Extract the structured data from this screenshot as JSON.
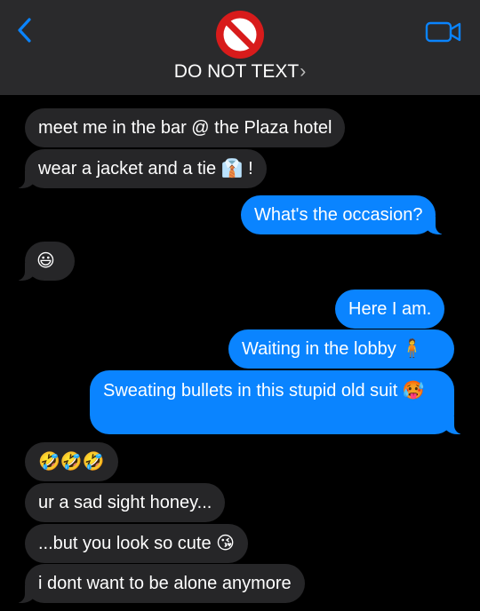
{
  "header": {
    "contact_name": "DO NOT TEXT",
    "chevron": "›",
    "back_icon": "chevron-left-icon",
    "avatar_icon": "prohibited-icon",
    "video_icon": "video-camera-icon",
    "accent_color": "#0a84ff"
  },
  "messages": [
    {
      "side": "incoming",
      "text": "meet me in the bar @ the Plaza hotel"
    },
    {
      "side": "incoming",
      "text": "wear a jacket and a tie 👔 !"
    },
    {
      "side": "outgoing",
      "text": "What's the occasion?"
    },
    {
      "side": "incoming",
      "text": "😃"
    },
    {
      "side": "outgoing",
      "text": "Here I am."
    },
    {
      "side": "outgoing",
      "text": "Waiting in the lobby 🧍"
    },
    {
      "side": "outgoing",
      "text": "Sweating bullets in this stupid old suit 🥵"
    },
    {
      "side": "incoming",
      "text": "🤣🤣🤣"
    },
    {
      "side": "incoming",
      "text": "ur a sad sight honey..."
    },
    {
      "side": "incoming",
      "text": "...but you look so cute 😘"
    },
    {
      "side": "incoming",
      "text": "i dont want to be alone anymore"
    }
  ],
  "colors": {
    "incoming_bubble": "#262628",
    "outgoing_bubble": "#0a84ff",
    "header_bg": "#2a2a2c"
  }
}
